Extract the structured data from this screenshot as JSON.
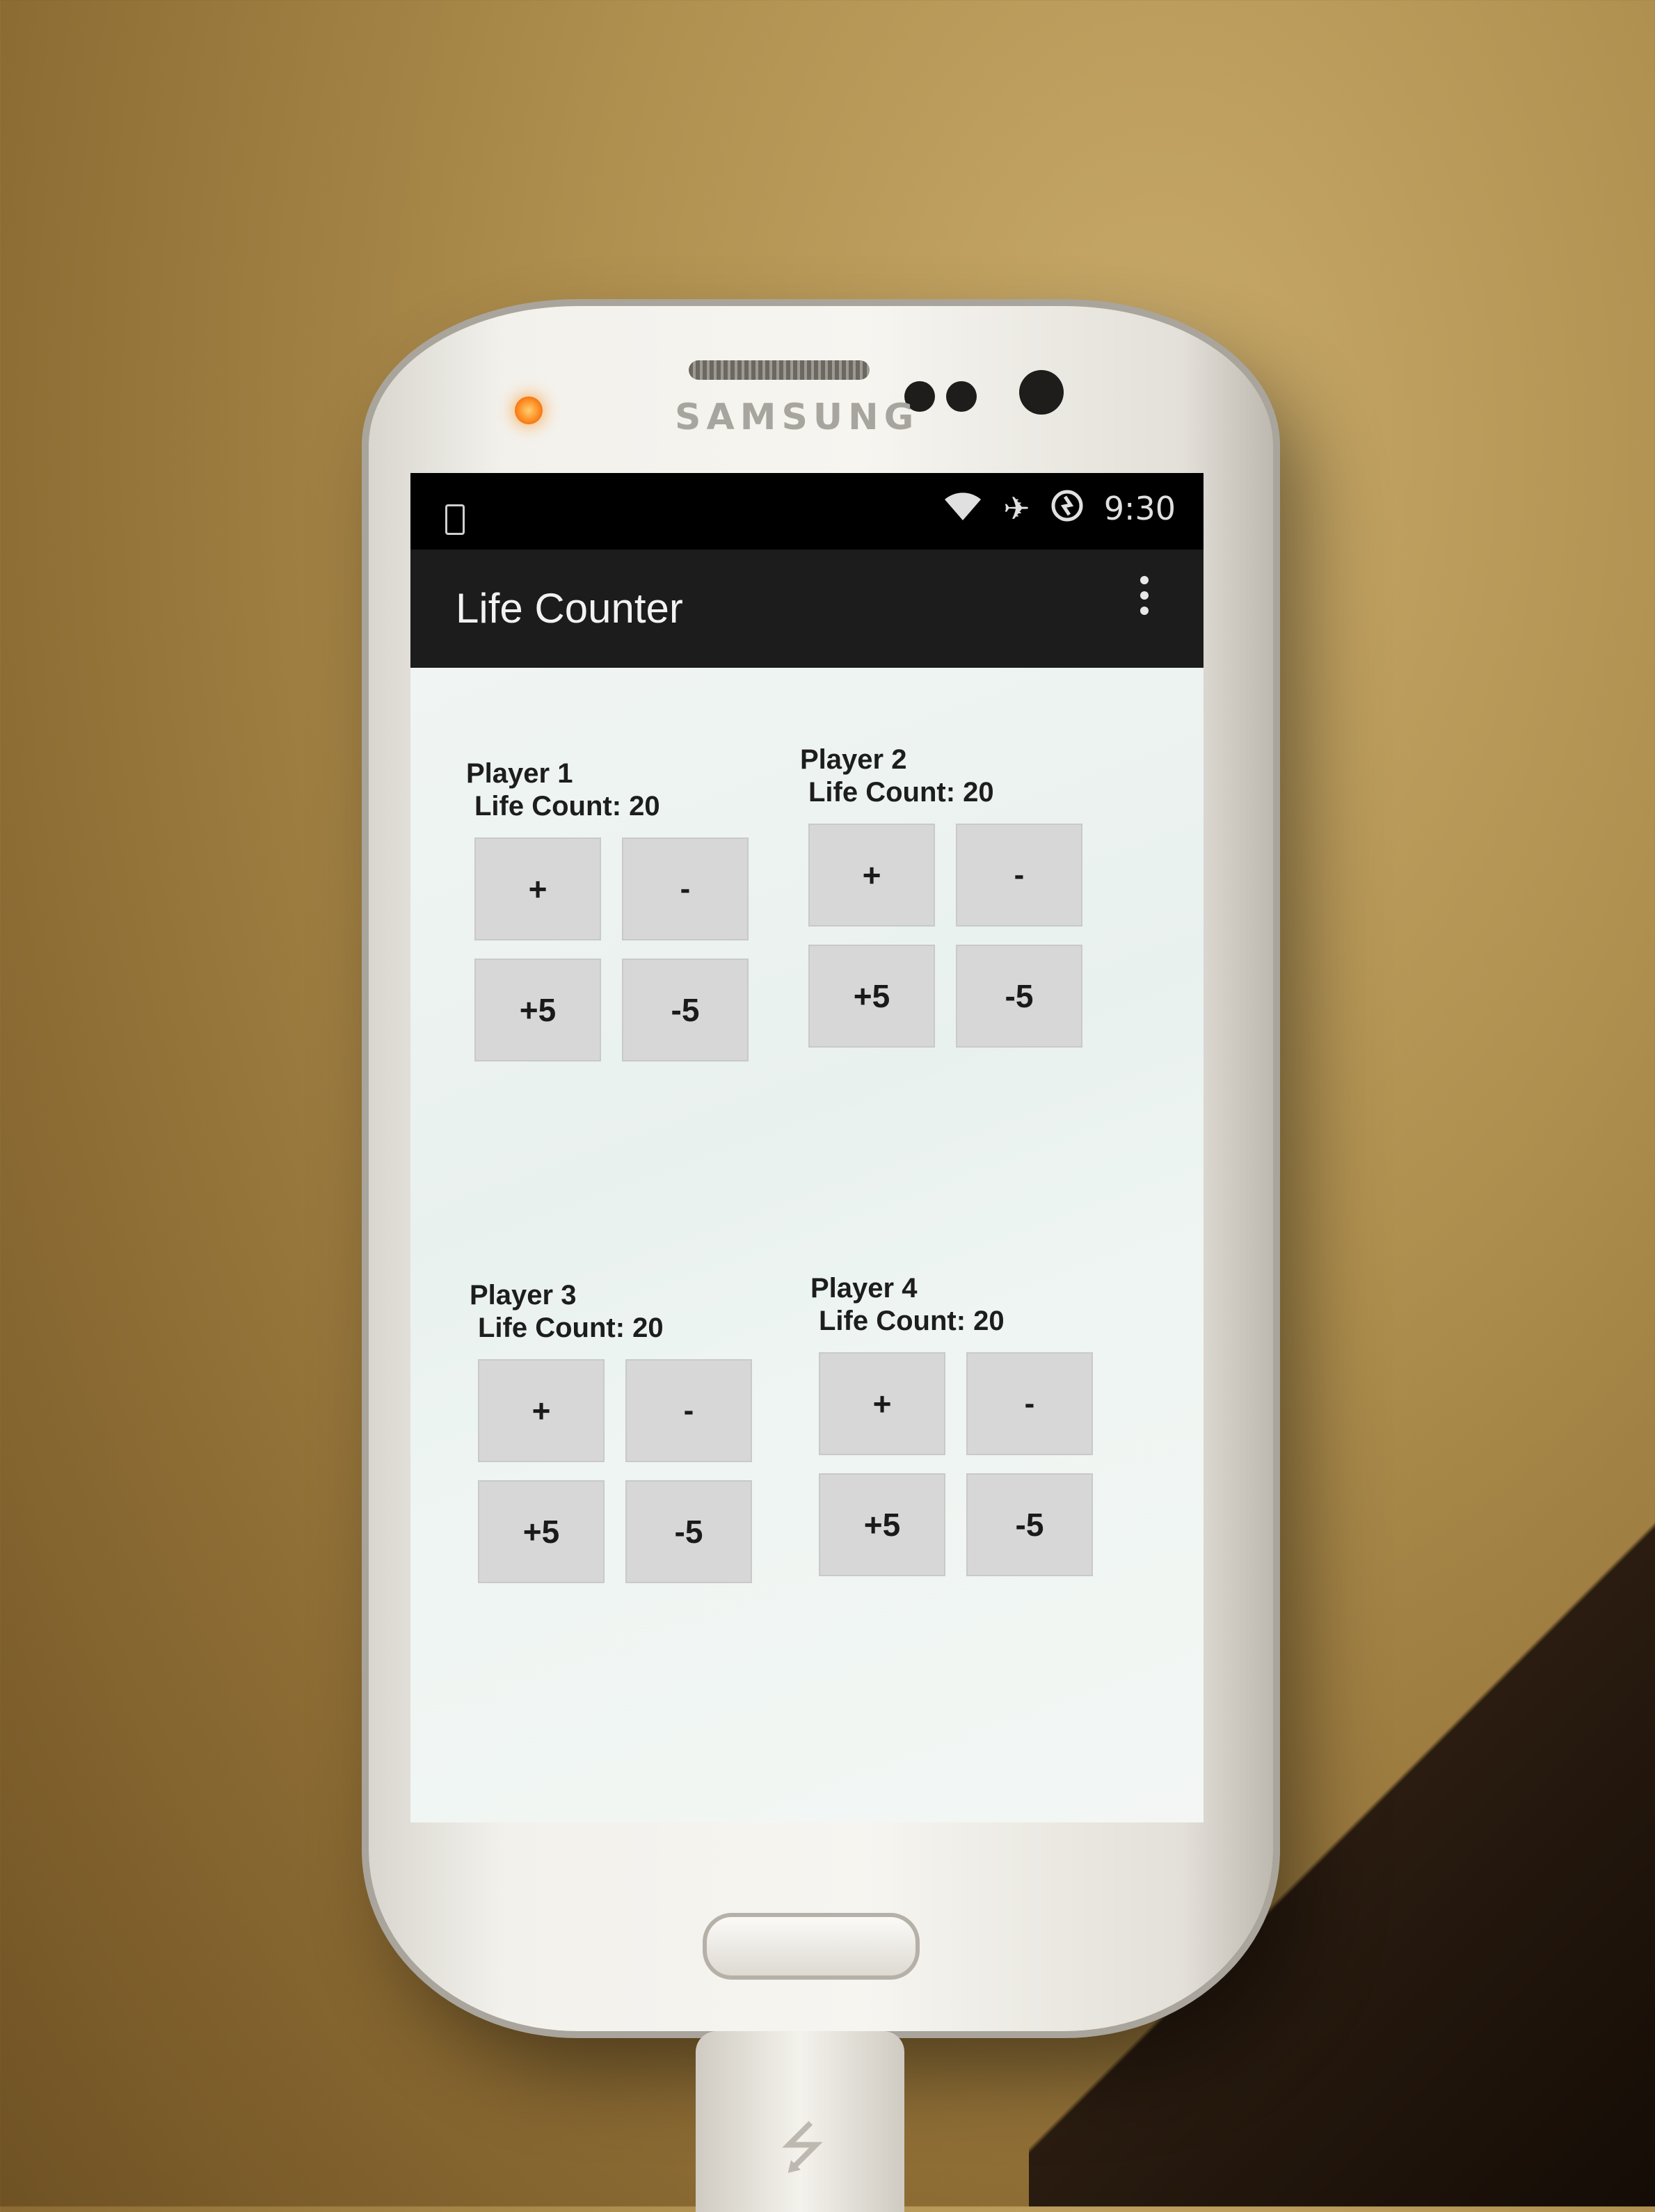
{
  "device": {
    "brand": "SAMSUNG"
  },
  "status_bar": {
    "time": "9:30",
    "icons": [
      "phone-notification-icon",
      "wifi-icon",
      "airplane-mode-icon",
      "sync-icon"
    ]
  },
  "action_bar": {
    "title": "Life Counter",
    "menu_icon": "overflow-menu-icon"
  },
  "players": [
    {
      "name": "Player 1",
      "life_count": "Life Count: 20",
      "buttons": {
        "plus_one": "+",
        "minus_one": "-",
        "plus_five": "+5",
        "minus_five": "-5"
      }
    },
    {
      "name": "Player 2",
      "life_count": "Life Count: 20",
      "buttons": {
        "plus_one": "+",
        "minus_one": "-",
        "plus_five": "+5",
        "minus_five": "-5"
      }
    },
    {
      "name": "Player 3",
      "life_count": "Life Count: 20",
      "buttons": {
        "plus_one": "+",
        "minus_one": "-",
        "plus_five": "+5",
        "minus_five": "-5"
      }
    },
    {
      "name": "Player 4",
      "life_count": "Life Count: 20",
      "buttons": {
        "plus_one": "+",
        "minus_one": "-",
        "plus_five": "+5",
        "minus_five": "-5"
      }
    }
  ],
  "colors": {
    "button_bg": "#d6d7d6",
    "content_bg": "#eef4f2",
    "action_bar_bg": "#1c1c1c"
  }
}
